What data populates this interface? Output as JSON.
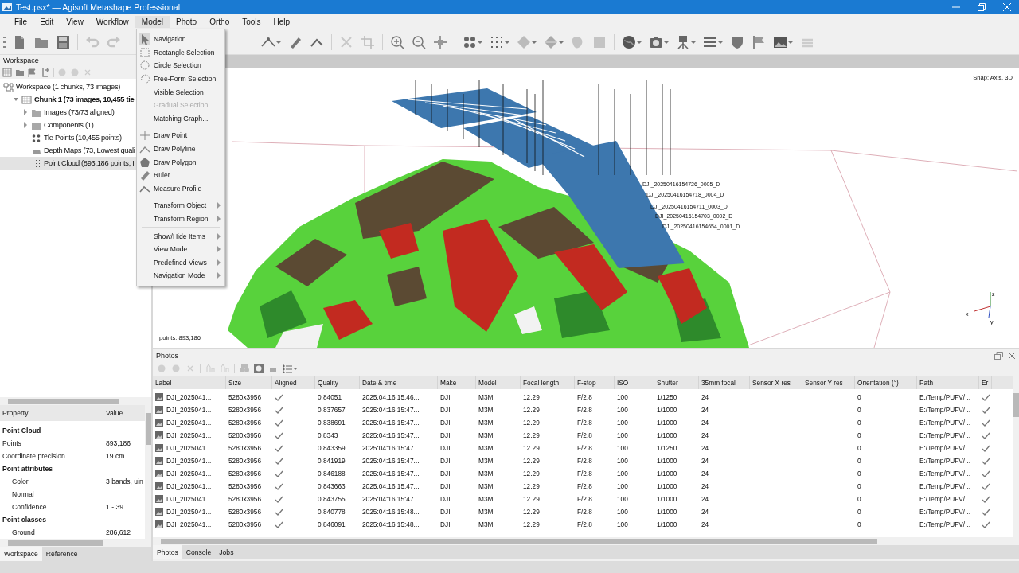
{
  "window": {
    "title": "Test.psx* — Agisoft Metashape Professional"
  },
  "menu_bar": [
    {
      "label": "File",
      "selected": false
    },
    {
      "label": "Edit",
      "selected": false
    },
    {
      "label": "View",
      "selected": false
    },
    {
      "label": "Workflow",
      "selected": false
    },
    {
      "label": "Model",
      "selected": true
    },
    {
      "label": "Photo",
      "selected": false
    },
    {
      "label": "Ortho",
      "selected": false
    },
    {
      "label": "Tools",
      "selected": false
    },
    {
      "label": "Help",
      "selected": false
    }
  ],
  "model_menu": {
    "groups": [
      [
        {
          "label": "Navigation",
          "kind": "action",
          "checked": true,
          "disabled": false
        },
        {
          "label": "Rectangle Selection",
          "kind": "action",
          "checked": false,
          "disabled": false
        },
        {
          "label": "Circle Selection",
          "kind": "action",
          "checked": false,
          "disabled": false
        },
        {
          "label": "Free-Form Selection",
          "kind": "action",
          "checked": false,
          "disabled": false
        },
        {
          "label": "Visible Selection",
          "kind": "action",
          "checked": false,
          "disabled": false
        },
        {
          "label": "Gradual Selection...",
          "kind": "action",
          "checked": false,
          "disabled": true
        },
        {
          "label": "Matching Graph...",
          "kind": "action",
          "checked": false,
          "disabled": false
        }
      ],
      [
        {
          "label": "Draw Point",
          "kind": "action",
          "checked": false,
          "disabled": false
        },
        {
          "label": "Draw Polyline",
          "kind": "action",
          "checked": false,
          "disabled": false
        },
        {
          "label": "Draw Polygon",
          "kind": "action",
          "checked": false,
          "disabled": false
        },
        {
          "label": "Ruler",
          "kind": "action",
          "checked": false,
          "disabled": false
        },
        {
          "label": "Measure Profile",
          "kind": "action",
          "checked": false,
          "disabled": false
        }
      ],
      [
        {
          "label": "Transform Object",
          "kind": "submenu",
          "checked": false,
          "disabled": false
        },
        {
          "label": "Transform Region",
          "kind": "submenu",
          "checked": false,
          "disabled": false
        }
      ],
      [
        {
          "label": "Show/Hide Items",
          "kind": "submenu",
          "checked": false,
          "disabled": false
        },
        {
          "label": "View Mode",
          "kind": "submenu",
          "checked": false,
          "disabled": false
        },
        {
          "label": "Predefined Views",
          "kind": "submenu",
          "checked": false,
          "disabled": false
        },
        {
          "label": "Navigation Mode",
          "kind": "submenu",
          "checked": false,
          "disabled": false
        }
      ]
    ]
  },
  "workspace": {
    "title": "Workspace",
    "tree": [
      {
        "label": "Workspace (1 chunks, 73 images)",
        "kind": "workspace",
        "selected": false,
        "children": [
          {
            "label": "Chunk 1 (73 images, 10,455 tie",
            "kind": "chunk",
            "selected": false,
            "expanded": true,
            "children": [
              {
                "label": "Images (73/73 aligned)",
                "kind": "folder",
                "selected": false,
                "expanded": false
              },
              {
                "label": "Components (1)",
                "kind": "folder",
                "selected": false,
                "expanded": false
              },
              {
                "label": "Tie Points (10,455 points)",
                "kind": "tie_points",
                "selected": false
              },
              {
                "label": "Depth Maps (73, Lowest quali",
                "kind": "depth_maps",
                "selected": false
              },
              {
                "label": "Point Cloud (893,186 points, I",
                "kind": "point_cloud",
                "selected": true
              }
            ]
          }
        ]
      }
    ]
  },
  "properties": {
    "columns": [
      "Property",
      "Value"
    ],
    "rows": [
      {
        "kind": "section",
        "name": "Point Cloud"
      },
      {
        "kind": "field",
        "name": "Points",
        "value": "893,186"
      },
      {
        "kind": "field",
        "name": "Coordinate precision",
        "value": "19 cm"
      },
      {
        "kind": "section",
        "name": "Point attributes"
      },
      {
        "kind": "subfield",
        "name": "Color",
        "value": "3 bands, uin"
      },
      {
        "kind": "subfield",
        "name": "Normal"
      },
      {
        "kind": "subfield",
        "name": "Confidence",
        "value": "1 - 39"
      },
      {
        "kind": "section",
        "name": "Point classes"
      },
      {
        "kind": "subfield",
        "name": "Ground",
        "value": "286,612"
      }
    ]
  },
  "left_tabs": [
    {
      "label": "Workspace",
      "selected": true
    },
    {
      "label": "Reference",
      "selected": false
    }
  ],
  "viewport": {
    "snap": "Snap: Axis, 3D",
    "points": "points: 893,186",
    "camera_labels": [
      "DJI_20250416154726_0005_D",
      "DJI_20250416154718_0004_D",
      "DJI_20250416154711_0003_D",
      "DJI_20250416154703_0002_D",
      "DJI_20250416154654_0001_D"
    ],
    "axes": [
      "z",
      "x",
      "y"
    ]
  },
  "photos": {
    "title": "Photos",
    "columns": [
      "Label",
      "Size",
      "Aligned",
      "Quality",
      "Date & time",
      "Make",
      "Model",
      "Focal length",
      "F-stop",
      "ISO",
      "Shutter",
      "35mm focal",
      "Sensor X res",
      "Sensor Y res",
      "Orientation (°)",
      "Path",
      "Er"
    ],
    "rows": [
      {
        "label": "DJI_2025041...",
        "size": "5280x3956",
        "aligned": true,
        "quality": "0.84051",
        "date": "2025:04:16 15:46...",
        "make": "DJI",
        "model": "M3M",
        "focal": "12.29",
        "fstop": "F/2.8",
        "iso": "100",
        "shutter": "1/1250",
        "focal35": "24",
        "orientation": "0",
        "path": "E:/Temp/PUFV/...",
        "er": true
      },
      {
        "label": "DJI_2025041...",
        "size": "5280x3956",
        "aligned": true,
        "quality": "0.837657",
        "date": "2025:04:16 15:47...",
        "make": "DJI",
        "model": "M3M",
        "focal": "12.29",
        "fstop": "F/2.8",
        "iso": "100",
        "shutter": "1/1000",
        "focal35": "24",
        "orientation": "0",
        "path": "E:/Temp/PUFV/...",
        "er": true
      },
      {
        "label": "DJI_2025041...",
        "size": "5280x3956",
        "aligned": true,
        "quality": "0.838691",
        "date": "2025:04:16 15:47...",
        "make": "DJI",
        "model": "M3M",
        "focal": "12.29",
        "fstop": "F/2.8",
        "iso": "100",
        "shutter": "1/1000",
        "focal35": "24",
        "orientation": "0",
        "path": "E:/Temp/PUFV/...",
        "er": true
      },
      {
        "label": "DJI_2025041...",
        "size": "5280x3956",
        "aligned": true,
        "quality": "0.8343",
        "date": "2025:04:16 15:47...",
        "make": "DJI",
        "model": "M3M",
        "focal": "12.29",
        "fstop": "F/2.8",
        "iso": "100",
        "shutter": "1/1000",
        "focal35": "24",
        "orientation": "0",
        "path": "E:/Temp/PUFV/...",
        "er": true
      },
      {
        "label": "DJI_2025041...",
        "size": "5280x3956",
        "aligned": true,
        "quality": "0.843359",
        "date": "2025:04:16 15:47...",
        "make": "DJI",
        "model": "M3M",
        "focal": "12.29",
        "fstop": "F/2.8",
        "iso": "100",
        "shutter": "1/1250",
        "focal35": "24",
        "orientation": "0",
        "path": "E:/Temp/PUFV/...",
        "er": true
      },
      {
        "label": "DJI_2025041...",
        "size": "5280x3956",
        "aligned": true,
        "quality": "0.841919",
        "date": "2025:04:16 15:47...",
        "make": "DJI",
        "model": "M3M",
        "focal": "12.29",
        "fstop": "F/2.8",
        "iso": "100",
        "shutter": "1/1000",
        "focal35": "24",
        "orientation": "0",
        "path": "E:/Temp/PUFV/...",
        "er": true
      },
      {
        "label": "DJI_2025041...",
        "size": "5280x3956",
        "aligned": true,
        "quality": "0.846188",
        "date": "2025:04:16 15:47...",
        "make": "DJI",
        "model": "M3M",
        "focal": "12.29",
        "fstop": "F/2.8",
        "iso": "100",
        "shutter": "1/1000",
        "focal35": "24",
        "orientation": "0",
        "path": "E:/Temp/PUFV/...",
        "er": true
      },
      {
        "label": "DJI_2025041...",
        "size": "5280x3956",
        "aligned": true,
        "quality": "0.843663",
        "date": "2025:04:16 15:47...",
        "make": "DJI",
        "model": "M3M",
        "focal": "12.29",
        "fstop": "F/2.8",
        "iso": "100",
        "shutter": "1/1000",
        "focal35": "24",
        "orientation": "0",
        "path": "E:/Temp/PUFV/...",
        "er": true
      },
      {
        "label": "DJI_2025041...",
        "size": "5280x3956",
        "aligned": true,
        "quality": "0.843755",
        "date": "2025:04:16 15:47...",
        "make": "DJI",
        "model": "M3M",
        "focal": "12.29",
        "fstop": "F/2.8",
        "iso": "100",
        "shutter": "1/1000",
        "focal35": "24",
        "orientation": "0",
        "path": "E:/Temp/PUFV/...",
        "er": true
      },
      {
        "label": "DJI_2025041...",
        "size": "5280x3956",
        "aligned": true,
        "quality": "0.840778",
        "date": "2025:04:16 15:48...",
        "make": "DJI",
        "model": "M3M",
        "focal": "12.29",
        "fstop": "F/2.8",
        "iso": "100",
        "shutter": "1/1000",
        "focal35": "24",
        "orientation": "0",
        "path": "E:/Temp/PUFV/...",
        "er": true
      },
      {
        "label": "DJI_2025041...",
        "size": "5280x3956",
        "aligned": true,
        "quality": "0.846091",
        "date": "2025:04:16 15:48...",
        "make": "DJI",
        "model": "M3M",
        "focal": "12.29",
        "fstop": "F/2.8",
        "iso": "100",
        "shutter": "1/1000",
        "focal35": "24",
        "orientation": "0",
        "path": "E:/Temp/PUFV/...",
        "er": true
      }
    ]
  },
  "bottom_tabs": [
    {
      "label": "Photos",
      "selected": true
    },
    {
      "label": "Console",
      "selected": false
    },
    {
      "label": "Jobs",
      "selected": false
    }
  ]
}
